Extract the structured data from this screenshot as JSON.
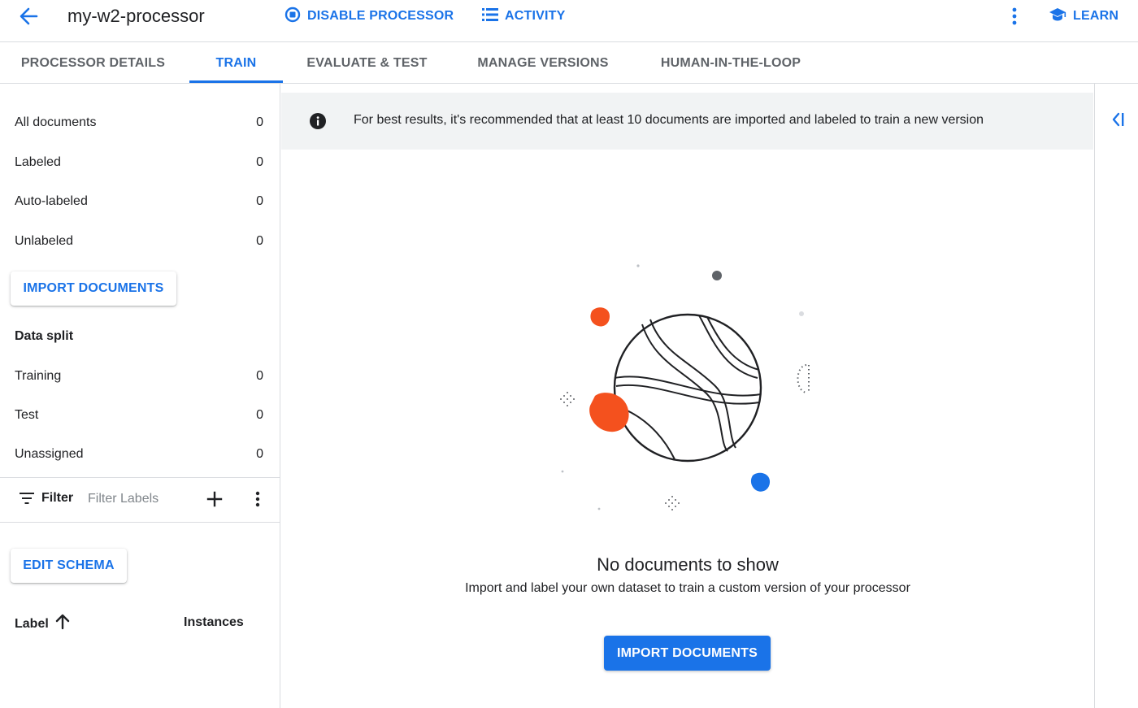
{
  "header": {
    "title": "my-w2-processor",
    "disable_label": "DISABLE PROCESSOR",
    "activity_label": "ACTIVITY",
    "learn_label": "LEARN"
  },
  "tabs": [
    {
      "label": "PROCESSOR DETAILS",
      "active": false
    },
    {
      "label": "TRAIN",
      "active": true
    },
    {
      "label": "EVALUATE & TEST",
      "active": false
    },
    {
      "label": "MANAGE VERSIONS",
      "active": false
    },
    {
      "label": "HUMAN-IN-THE-LOOP",
      "active": false
    }
  ],
  "sidebar": {
    "doc_counts": [
      {
        "label": "All documents",
        "count": "0"
      },
      {
        "label": "Labeled",
        "count": "0"
      },
      {
        "label": "Auto-labeled",
        "count": "0"
      },
      {
        "label": "Unlabeled",
        "count": "0"
      }
    ],
    "import_label": "IMPORT DOCUMENTS",
    "data_split_title": "Data split",
    "split_counts": [
      {
        "label": "Training",
        "count": "0"
      },
      {
        "label": "Test",
        "count": "0"
      },
      {
        "label": "Unassigned",
        "count": "0"
      }
    ],
    "filter_label": "Filter",
    "filter_placeholder": "Filter Labels",
    "edit_schema_label": "EDIT SCHEMA",
    "label_col": "Label",
    "instances_col": "Instances"
  },
  "main": {
    "banner_text": "For best results, it's recommended that at least 10 documents are imported and labeled to train a new version",
    "empty_title": "No documents to show",
    "empty_subtitle": "Import and label your own dataset to train a custom version of your processor",
    "import_button": "IMPORT DOCUMENTS"
  },
  "colors": {
    "accent": "#1a73e8",
    "illustration_orange": "#f4511e",
    "illustration_blue": "#1a73e8"
  }
}
